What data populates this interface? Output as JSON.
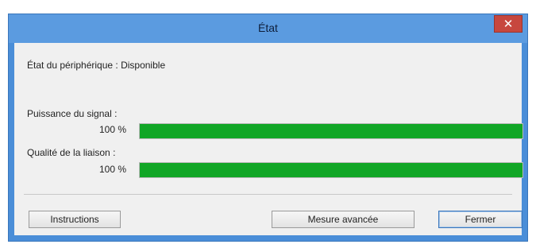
{
  "window": {
    "title": "État",
    "close_glyph": "✕"
  },
  "device_status": "État du périphérique : Disponible",
  "signal": {
    "label": "Puissance du signal :",
    "value_text": "100 %",
    "value": 100
  },
  "link": {
    "label": "Qualité de la liaison :",
    "value_text": "100 %",
    "value": 100
  },
  "buttons": {
    "instructions": "Instructions",
    "advanced": "Mesure avancée",
    "close": "Fermer"
  },
  "colors": {
    "bar_fill": "#11a626",
    "titlebar": "#5b9be0",
    "close": "#c7473e"
  }
}
